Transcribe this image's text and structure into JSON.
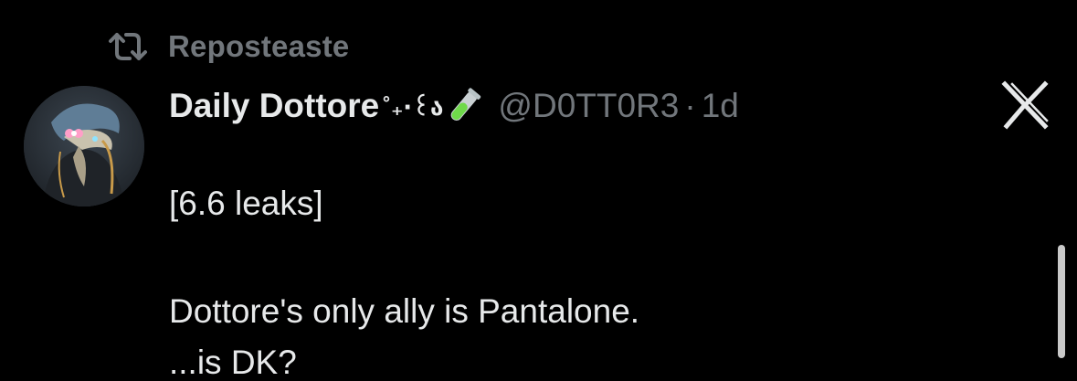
{
  "repost": {
    "icon": "repost-icon",
    "label": "Reposteaste"
  },
  "post": {
    "author": {
      "display_name": "Daily Dottore",
      "name_decoration": "˚₊‧꒰ა",
      "name_emoji": "test-tube-icon",
      "handle": "@D0TT0R3",
      "separator": "·",
      "time": "1d",
      "avatar": "avatar-plague-doctor"
    },
    "lines": [
      "[6.6 leaks]",
      "Dottore's only ally is Pantalone.",
      "...is DK?"
    ],
    "grok_icon": "grok-x-icon"
  },
  "colors": {
    "background": "#000000",
    "primary_text": "#e7e9ea",
    "secondary_text": "#71767b",
    "scrollbar": "#c9c9c9"
  }
}
